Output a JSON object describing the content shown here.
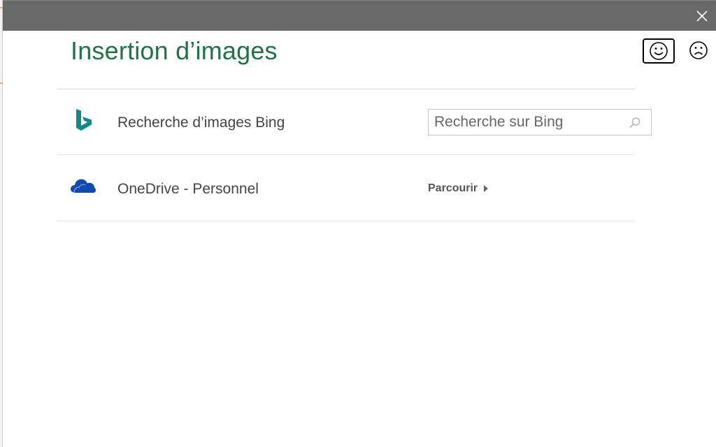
{
  "dialog": {
    "title": "Insertion d’images"
  },
  "sources": [
    {
      "label": "Recherche d’images Bing",
      "search_placeholder": "Recherche sur Bing",
      "icon": "bing-logo-icon"
    },
    {
      "label": "OneDrive - Personnel",
      "action_label": "Parcourir",
      "icon": "onedrive-cloud-icon"
    }
  ],
  "colors": {
    "title_green": "#217346",
    "titlebar_gray": "#696969",
    "bing_teal": "#138a8a",
    "onedrive_blue": "#0f4bb3"
  },
  "icons": [
    "close-icon",
    "smile-icon",
    "frown-icon",
    "bing-logo-icon",
    "onedrive-cloud-icon",
    "search-icon",
    "arrow-right-icon"
  ]
}
